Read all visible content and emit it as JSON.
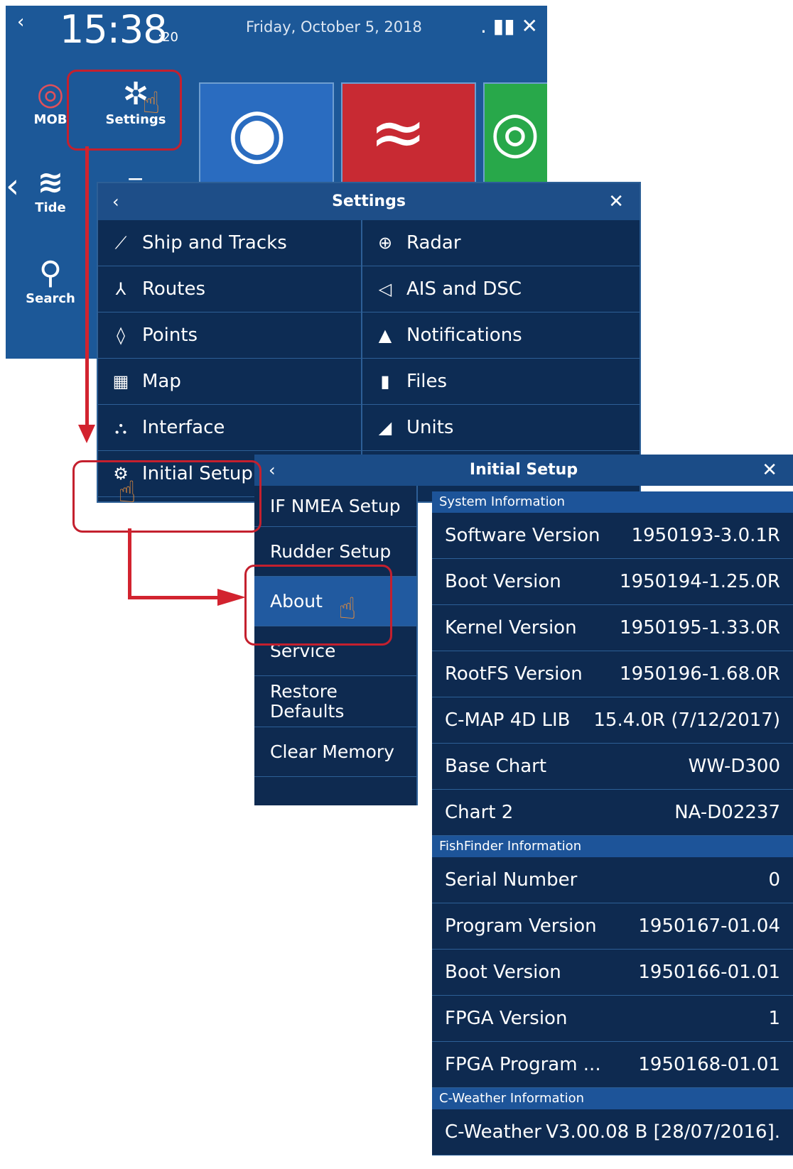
{
  "home": {
    "time": "15:38",
    "seconds": ":20",
    "date": "Friday, October 5, 2018",
    "side_buttons": [
      {
        "label": "MOB",
        "icon": "lifebuoy-icon"
      },
      {
        "label": "Settings",
        "icon": "gear-icon"
      },
      {
        "label": "Tide",
        "icon": "waves-icon"
      },
      {
        "label": "Search",
        "icon": "magnifier-icon"
      }
    ]
  },
  "settings": {
    "title": "Settings",
    "items": [
      {
        "label": "Ship and Tracks",
        "icon": "track-icon"
      },
      {
        "label": "Radar",
        "icon": "radar-icon"
      },
      {
        "label": "Routes",
        "icon": "route-icon"
      },
      {
        "label": "AIS and DSC",
        "icon": "ais-icon"
      },
      {
        "label": "Points",
        "icon": "waypoint-icon"
      },
      {
        "label": "Notifications",
        "icon": "warning-icon"
      },
      {
        "label": "Map",
        "icon": "map-icon"
      },
      {
        "label": "Files",
        "icon": "file-icon"
      },
      {
        "label": "Interface",
        "icon": "network-icon"
      },
      {
        "label": "Units",
        "icon": "units-icon"
      }
    ],
    "extra_item": {
      "label": "Initial Setup",
      "icon": "wrench-gear-icon"
    }
  },
  "initial_setup": {
    "title": "Initial Setup",
    "left_items": [
      "IF NMEA Setup",
      "Rudder Setup",
      "About",
      "Service",
      "Restore Defaults",
      "Clear Memory"
    ],
    "active_item": "About",
    "sections": [
      {
        "title": "System Information",
        "rows": [
          {
            "label": "Software Version",
            "value": "1950193-3.0.1R"
          },
          {
            "label": "Boot Version",
            "value": "1950194-1.25.0R"
          },
          {
            "label": "Kernel Version",
            "value": "1950195-1.33.0R"
          },
          {
            "label": "RootFS Version",
            "value": "1950196-1.68.0R"
          },
          {
            "label": "C-MAP 4D LIB",
            "value": "15.4.0R (7/12/2017)"
          },
          {
            "label": "Base Chart",
            "value": "WW-D300"
          },
          {
            "label": "Chart 2",
            "value": "NA-D02237"
          }
        ]
      },
      {
        "title": "FishFinder Information",
        "rows": [
          {
            "label": "Serial Number",
            "value": "0"
          },
          {
            "label": "Program Version",
            "value": "1950167-01.04"
          },
          {
            "label": "Boot Version",
            "value": "1950166-01.01"
          },
          {
            "label": "FPGA Version",
            "value": "1"
          },
          {
            "label": "FPGA Program ...",
            "value": "1950168-01.01"
          }
        ]
      },
      {
        "title": "C-Weather Information",
        "rows": [
          {
            "label": "C-Weather",
            "value": "V3.00.08 B [28/07/2016]."
          }
        ]
      }
    ]
  },
  "colors": {
    "panel": "#0e2a50",
    "header": "#1e4e88",
    "highlight": "#c4202e"
  }
}
